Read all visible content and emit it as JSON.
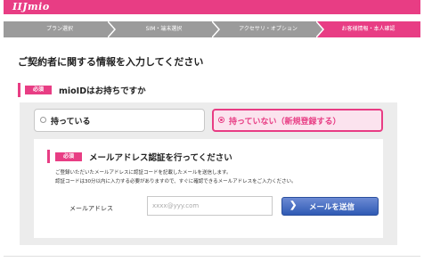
{
  "header": {
    "logo_text": "IIJmio",
    "brand_color": "#e83d84"
  },
  "steps": [
    {
      "label": "プラン選択",
      "active": false
    },
    {
      "label": "SIM・端末選択",
      "active": false
    },
    {
      "label": "アクセサリ・オプション",
      "active": false
    },
    {
      "label": "お客様情報・本人確認",
      "active": true
    }
  ],
  "page": {
    "title": "ご契約者に関する情報を入力してください"
  },
  "mioid_section": {
    "badge": "必須",
    "question": "mioIDはお持ちですか",
    "options": [
      {
        "label": "持っている",
        "selected": false
      },
      {
        "label": "持っていない（新規登録する）",
        "selected": true
      }
    ]
  },
  "email_auth": {
    "badge": "必須",
    "title": "メールアドレス認証を行ってください",
    "description_line1": "ご登録いただいたメールアドレスに認証コードを記載したメールを送信します。",
    "description_line2": "認証コードは30分以内に入力する必要がありますので、すぐに確認できるメールアドレスをご入力ください。",
    "field_label": "メールアドレス",
    "input_value": "",
    "input_placeholder": "xxxx@yyy.com",
    "send_button": "メールを送信",
    "button_icon": "chevron-right-icon"
  }
}
